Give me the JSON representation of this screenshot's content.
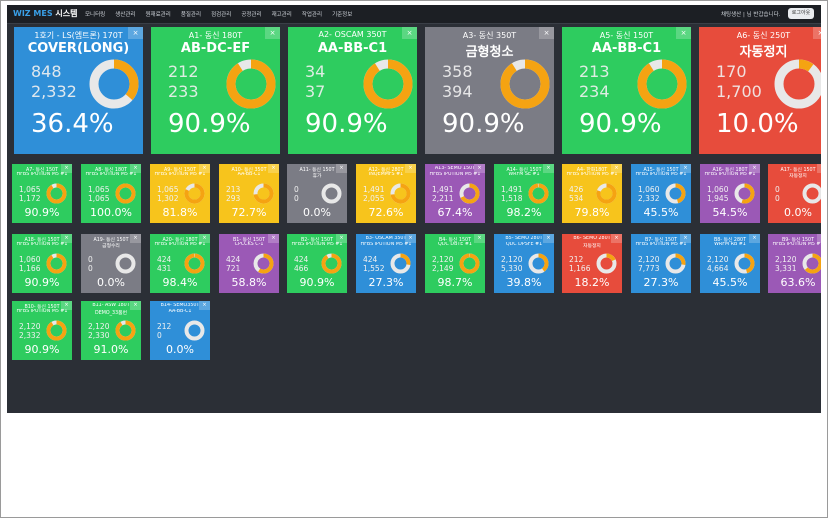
{
  "app": {
    "brand_main": "WIZ MES",
    "brand_sub": "시스템"
  },
  "menu": [
    "모니터링",
    "생산관리",
    "원재료관리",
    "품질관리",
    "점검관리",
    "공정관리",
    "재고관리",
    "작업관리",
    "기준정보"
  ],
  "user": {
    "greeting": "채팅생산 | 님 반갑습니다.",
    "logout_label": "로그아웃"
  },
  "close_glyph": "×",
  "colors": {
    "green": "#2ecc5f",
    "blue": "#2f8fd8",
    "gray": "#7b7c85",
    "red": "#e74c3c",
    "yellow": "#f7c41c",
    "purple": "#9b59b6",
    "ring_bg": "#e8e8e8",
    "ring_fg": "#f5a312"
  },
  "big_tiles": [
    {
      "line1": "1호기 - LS(엠트론) 170T",
      "line2": "COVER(LONG)",
      "n1": "848",
      "n2": "2,332",
      "pct": "36.4%",
      "value": 36.4,
      "color": "blue"
    },
    {
      "line1": "A1- 동신 180T",
      "line2": "AB-DC-EF",
      "n1": "212",
      "n2": "233",
      "pct": "90.9%",
      "value": 90.9,
      "color": "green"
    },
    {
      "line1": "A2- OSCAM 350T",
      "line2": "AA-BB-C1",
      "n1": "34",
      "n2": "37",
      "pct": "90.9%",
      "value": 90.9,
      "color": "green"
    },
    {
      "line1": "A3- 동신 350T",
      "line2": "금형청소",
      "n1": "358",
      "n2": "394",
      "pct": "90.9%",
      "value": 90.9,
      "color": "gray"
    },
    {
      "line1": "A5- 동신 150T",
      "line2": "AA-BB-C1",
      "n1": "213",
      "n2": "234",
      "pct": "90.9%",
      "value": 90.9,
      "color": "green"
    },
    {
      "line1": "A6- 동신 250T",
      "line2": "자동정지",
      "n1": "170",
      "n2": "1,700",
      "pct": "10.0%",
      "value": 10.0,
      "color": "red"
    }
  ],
  "small_tiles": [
    {
      "line1": "A7- 동신 150T",
      "line2": "HFBS IPUTION M5 #1",
      "n1": "1,065",
      "n2": "1,172",
      "pct": "90.9%",
      "value": 90.9,
      "color": "green"
    },
    {
      "line1": "A8- 동신 180T",
      "line2": "HFBS IPUTION M5 #1",
      "n1": "1,065",
      "n2": "1,065",
      "pct": "100.0%",
      "value": 100.0,
      "color": "green"
    },
    {
      "line1": "A9- 동신 150T",
      "line2": "HFBS IPUTION M5 #1",
      "n1": "1,065",
      "n2": "1,302",
      "pct": "81.8%",
      "value": 81.8,
      "color": "yellow"
    },
    {
      "line1": "A10- 동신 350T",
      "line2": "AA-BB-C1",
      "n1": "213",
      "n2": "293",
      "pct": "72.7%",
      "value": 72.7,
      "color": "yellow"
    },
    {
      "line1": "A11- 동신 150T",
      "line2": "휴가",
      "n1": "0",
      "n2": "0",
      "pct": "0.0%",
      "value": 0,
      "color": "gray"
    },
    {
      "line1": "A12- 동신 280T",
      "line2": "INQEMMFS #1",
      "n1": "1,491",
      "n2": "2,055",
      "pct": "72.6%",
      "value": 72.6,
      "color": "yellow"
    },
    {
      "line1": "A13- SEMO 150T",
      "line2": "HFBS IPUTION M5 #1",
      "n1": "1,491",
      "n2": "2,211",
      "pct": "67.4%",
      "value": 67.4,
      "color": "purple"
    },
    {
      "line1": "A14- 동신 150T",
      "line2": "WRFM SE #1",
      "n1": "1,491",
      "n2": "1,518",
      "pct": "98.2%",
      "value": 98.2,
      "color": "green"
    },
    {
      "line1": "A4- 한화180T",
      "line2": "HFBS IPUTION M5 #1",
      "n1": "426",
      "n2": "534",
      "pct": "79.8%",
      "value": 79.8,
      "color": "yellow"
    },
    {
      "line1": "A15- 동신 150T",
      "line2": "HFBS IPUTION M5 #1",
      "n1": "1,060",
      "n2": "2,332",
      "pct": "45.5%",
      "value": 45.5,
      "color": "blue"
    },
    {
      "line1": "A16- 동신 180T",
      "line2": "HFBS IPUTION M5 #1",
      "n1": "1,060",
      "n2": "1,945",
      "pct": "54.5%",
      "value": 54.5,
      "color": "purple"
    },
    {
      "line1": "A17- 동신 150T",
      "line2": "자동정지",
      "n1": "0",
      "n2": "0",
      "pct": "0.0%",
      "value": 0,
      "color": "red"
    },
    {
      "line1": "A18- 동신 150T",
      "line2": "HFBS IPUTION M5 #1",
      "n1": "1,060",
      "n2": "1,166",
      "pct": "90.9%",
      "value": 90.9,
      "color": "green"
    },
    {
      "line1": "A19- 동신 150T",
      "line2": "금형수리",
      "n1": "0",
      "n2": "0",
      "pct": "0.0%",
      "value": 0,
      "color": "gray"
    },
    {
      "line1": "A20- 동신 180T",
      "line2": "HFBS IPUTION M5 #1",
      "n1": "424",
      "n2": "431",
      "pct": "98.4%",
      "value": 98.4,
      "color": "green"
    },
    {
      "line1": "B1- 동신 150T",
      "line2": "CPCCKS C-1",
      "n1": "424",
      "n2": "721",
      "pct": "58.8%",
      "value": 58.8,
      "color": "purple"
    },
    {
      "line1": "B2- 동신 150T",
      "line2": "HFBS IPUTION M5 #1",
      "n1": "424",
      "n2": "466",
      "pct": "90.9%",
      "value": 90.9,
      "color": "green"
    },
    {
      "line1": "B3- OSCAM 350T",
      "line2": "HFBS IPUTION M5 #1",
      "n1": "424",
      "n2": "1,552",
      "pct": "27.3%",
      "value": 27.3,
      "color": "blue"
    },
    {
      "line1": "B4- 동신 150T",
      "line2": "QDC DBTE #1",
      "n1": "2,120",
      "n2": "2,149",
      "pct": "98.7%",
      "value": 98.7,
      "color": "green"
    },
    {
      "line1": "B5- SEMO 280T",
      "line2": "QDC DPSFE #1",
      "n1": "2,120",
      "n2": "5,330",
      "pct": "39.8%",
      "value": 39.8,
      "color": "blue"
    },
    {
      "line1": "B6- SEMO 280T",
      "line2": "자동정지",
      "n1": "212",
      "n2": "1,166",
      "pct": "18.2%",
      "value": 18.2,
      "color": "red"
    },
    {
      "line1": "B7- 동신 150T",
      "line2": "HFBS IPUTION M5 #1",
      "n1": "2,120",
      "n2": "7,773",
      "pct": "27.3%",
      "value": 27.3,
      "color": "blue"
    },
    {
      "line1": "B8- 동신 280T",
      "line2": "WRFM RB #1",
      "n1": "2,120",
      "n2": "4,664",
      "pct": "45.5%",
      "value": 45.5,
      "color": "blue"
    },
    {
      "line1": "B9- 동신 150T",
      "line2": "HFBS IPUTION M5 #1",
      "n1": "2,120",
      "n2": "3,331",
      "pct": "63.6%",
      "value": 63.6,
      "color": "purple"
    },
    {
      "line1": "B10- 동신 150T",
      "line2": "HFBS IPUTION M5 #1",
      "n1": "2,120",
      "n2": "2,332",
      "pct": "90.9%",
      "value": 90.9,
      "color": "green"
    },
    {
      "line1": "B11- ASW 180T",
      "line2": "DEMO_33품번",
      "n1": "2,120",
      "n2": "2,330",
      "pct": "91.0%",
      "value": 91.0,
      "color": "green"
    },
    {
      "line1": "B14- SEMO350T",
      "line2": "AA-BB-C1",
      "n1": "212",
      "n2": "0",
      "pct": "0.0%",
      "value": 0,
      "color": "blue"
    }
  ]
}
